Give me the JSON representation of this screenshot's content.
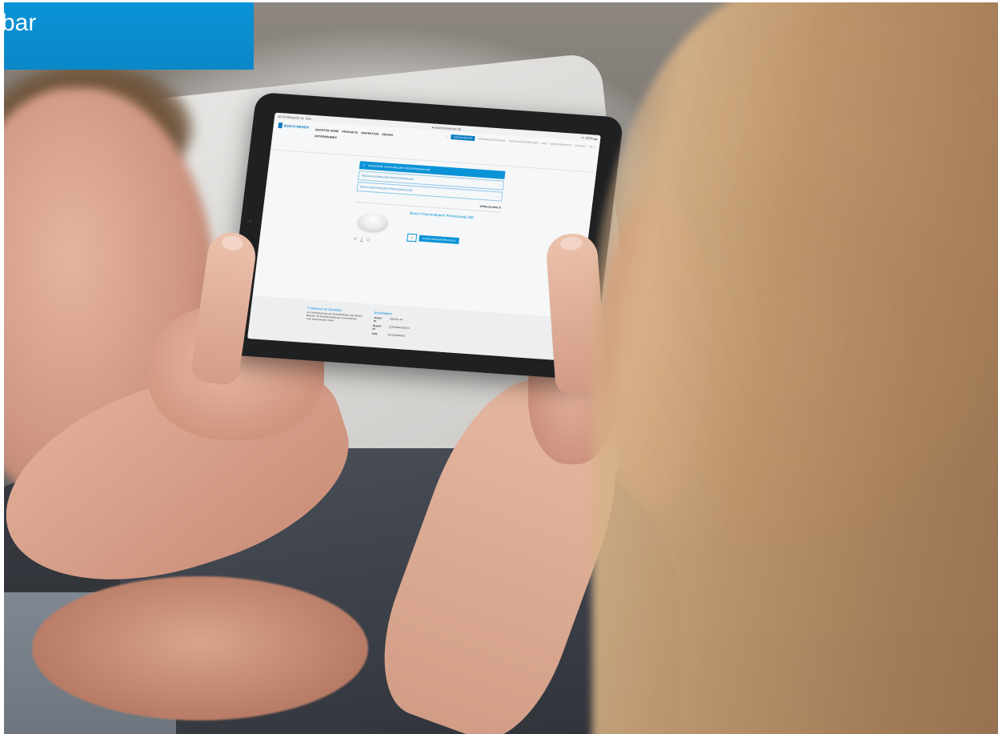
{
  "corner_label": {
    "text": "bar"
  },
  "tablet": {
    "status_left": "10:24   Mittwoch 14. Nov.",
    "status_center": "● boschsensortec.de",
    "status_right": "✦ 100% ▬",
    "logo": "BOSCH-MEDIEN",
    "nav_items": [
      "SMARTER HOME",
      "PRODUKTE",
      "INSPEKTION",
      "DESIGN",
      "UNTERNEHMEN"
    ],
    "top_nav": [
      "KONFIGURATOR",
      "WERKSAUSLIEFERUNG",
      "INSTALLATIONSPARTNER",
      "INFO",
      "BENUTZERKONTO",
      "KONTAKT",
      "DE ▾"
    ],
    "accordion_header": "KATEGORIE: RAUCHMELDER PROFESSIONALLINE",
    "accordion_rows": [
      "BOSCH-RAUCHMELDER PROFESSIONALLINE",
      "BOSCH-RAUCHMELDER PROFESSIONALLINE"
    ],
    "compare_label": "VERGLEICHEN",
    "product_title": "Bosch Rauchmelder® ProfessionalLINE",
    "product_sub": "—",
    "qty": "1",
    "cart_button": "IN DEN WARENKORB LEGEN",
    "footer_left_title": "Funktionen im Überblick",
    "footer_left_text": "Zur Früherkennung von Schwelbränden und offenen Bränden mit Rauchentwicklung in Innenräumen nach internationaler Norm.",
    "footer_right_title": "Bestelldaten",
    "footer_kv": [
      {
        "k": "Artikel-Nr.",
        "v": "6020701 44"
      },
      {
        "k": "Bestell-Nr.",
        "v": "ZCR03AR2-BD470"
      },
      {
        "k": "EAN:",
        "v": "4011260086042"
      }
    ]
  },
  "colors": {
    "brand_blue": "#0a93d7"
  }
}
